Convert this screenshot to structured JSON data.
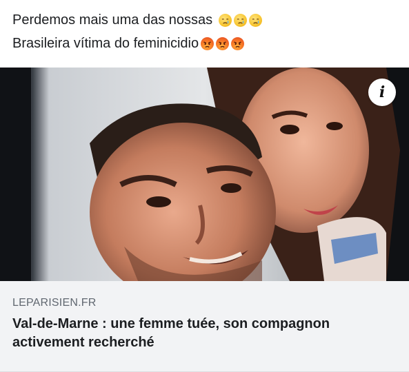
{
  "post": {
    "line1": "Perdemos mais uma das nossas",
    "line2": "Brasileira vítima do feminicidio",
    "line1_emojis": [
      "crying-face-emoji",
      "crying-face-emoji",
      "crying-face-emoji"
    ],
    "line2_emojis": [
      "angry-face-emoji",
      "angry-face-emoji",
      "angry-face-emoji"
    ]
  },
  "link_preview": {
    "domain": "LEPARISIEN.FR",
    "headline": "Val-de-Marne : une femme tuée, son compagnon activement recherché",
    "info_button_icon": "info-icon"
  },
  "colors": {
    "text": "#1c1e21",
    "domain_text": "#606770",
    "preview_background": "#f2f3f5"
  }
}
